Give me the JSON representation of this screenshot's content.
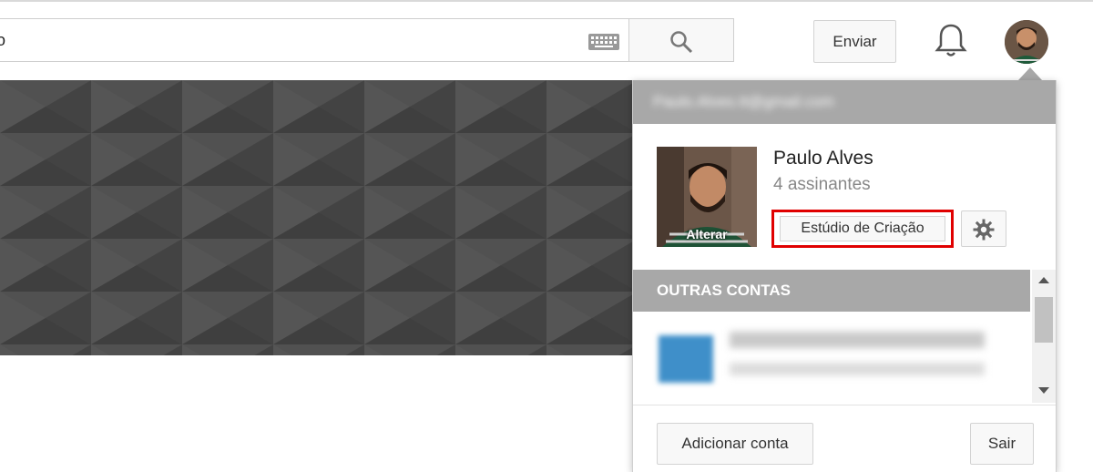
{
  "search": {
    "value": "o"
  },
  "header": {
    "upload_label": "Enviar"
  },
  "account_menu": {
    "email_blurred": "Paulo.Alves.tt@gmail.com",
    "user_name": "Paulo Alves",
    "subscribers": "4 assinantes",
    "photo_change_label": "Alterar",
    "studio_label": "Estúdio de Criação",
    "other_accounts_label": "OUTRAS CONTAS",
    "other_account_email_blurred": "gabriela.silva@gmail.com",
    "add_account_label": "Adicionar conta",
    "sign_out_label": "Sair"
  },
  "colors": {
    "highlight": "#e00000",
    "banner": "#4d4d4d",
    "section_bar": "#a8a8a8"
  }
}
